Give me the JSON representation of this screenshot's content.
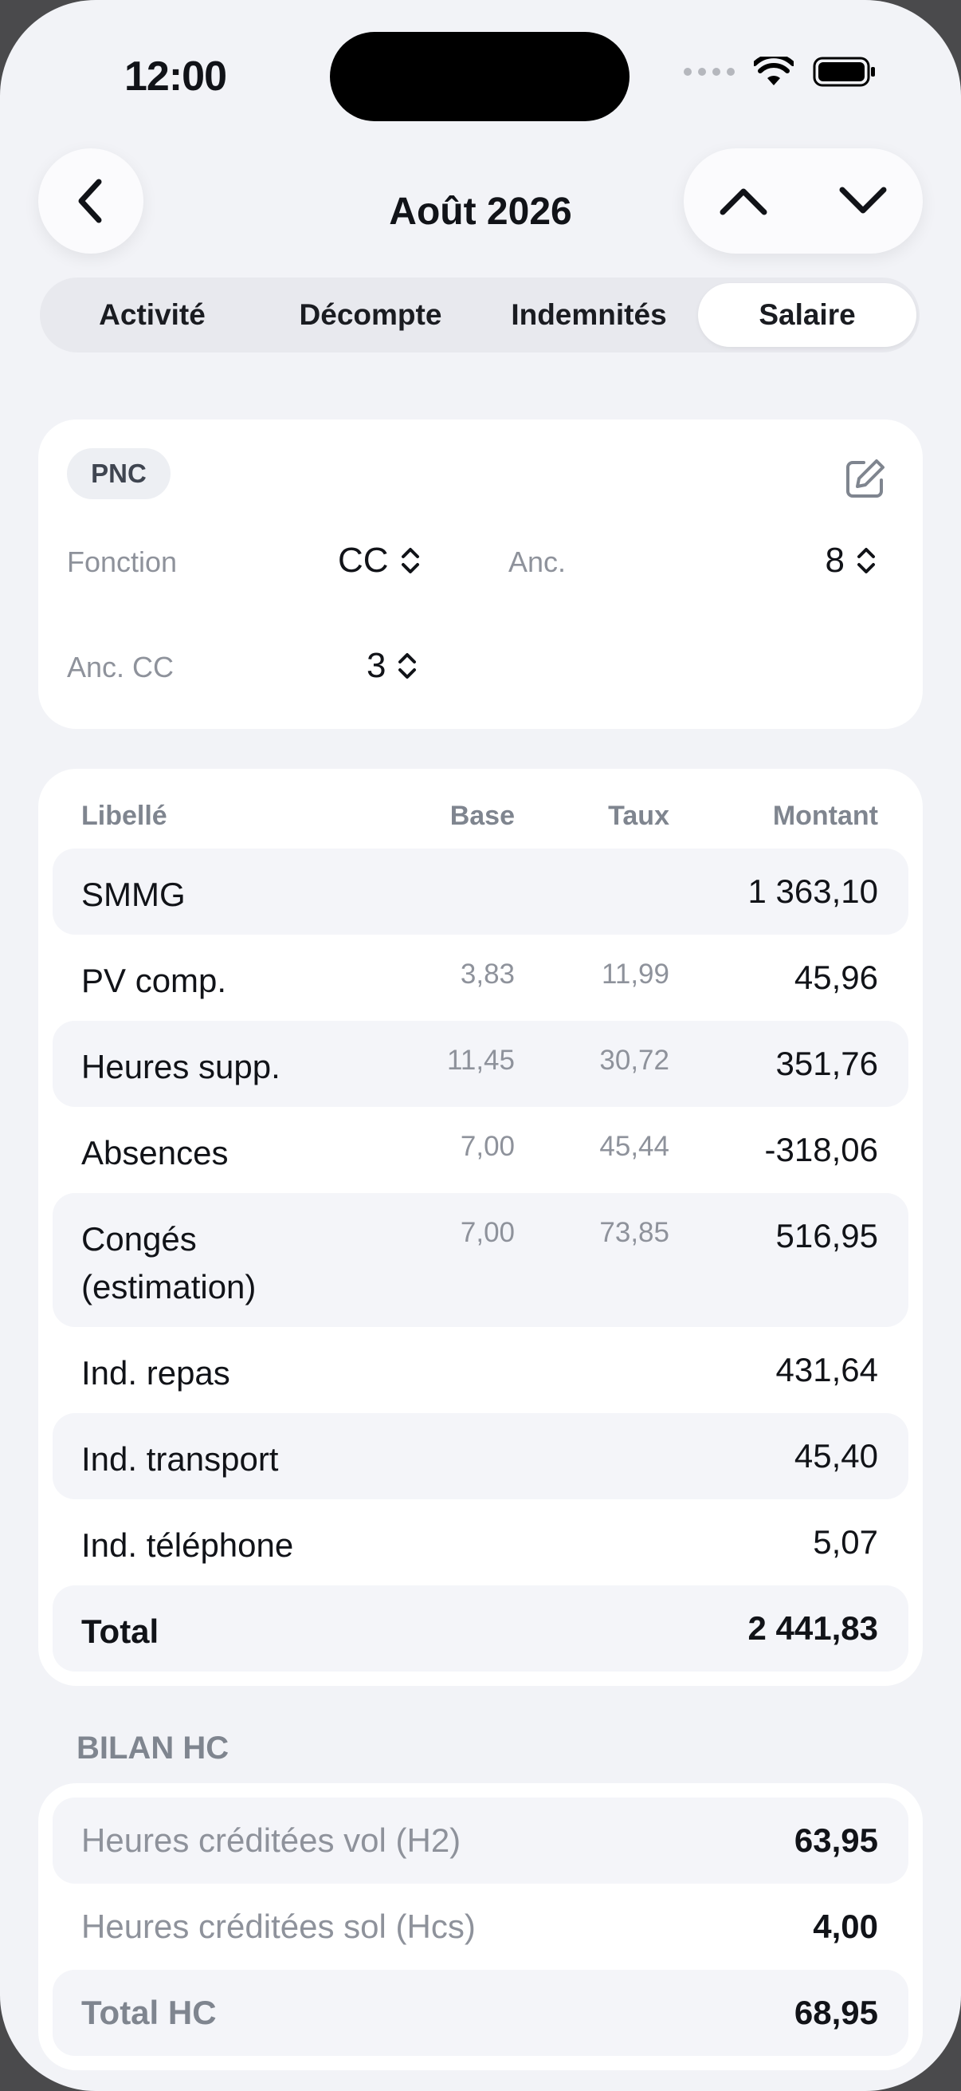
{
  "status": {
    "time": "12:00"
  },
  "nav": {
    "title": "Août 2026"
  },
  "tabs": [
    {
      "label": "Activité",
      "active": false
    },
    {
      "label": "Décompte",
      "active": false
    },
    {
      "label": "Indemnités",
      "active": false
    },
    {
      "label": "Salaire",
      "active": true
    }
  ],
  "profile": {
    "badge": "PNC",
    "fonction": {
      "label": "Fonction",
      "value": "CC"
    },
    "anc": {
      "label": "Anc.",
      "value": "8"
    },
    "anc_cc": {
      "label": "Anc. CC",
      "value": "3"
    }
  },
  "salary_table": {
    "headers": {
      "label": "Libellé",
      "base": "Base",
      "rate": "Taux",
      "amount": "Montant"
    },
    "rows": [
      {
        "label": "SMMG",
        "base": "",
        "rate": "",
        "amount": "1 363,10"
      },
      {
        "label": "PV comp.",
        "base": "3,83",
        "rate": "11,99",
        "amount": "45,96"
      },
      {
        "label": "Heures supp.",
        "base": "11,45",
        "rate": "30,72",
        "amount": "351,76"
      },
      {
        "label": "Absences",
        "base": "7,00",
        "rate": "45,44",
        "amount": "-318,06"
      },
      {
        "label": "Congés (estimation)",
        "base": "7,00",
        "rate": "73,85",
        "amount": "516,95"
      },
      {
        "label": "Ind. repas",
        "base": "",
        "rate": "",
        "amount": "431,64"
      },
      {
        "label": "Ind. transport",
        "base": "",
        "rate": "",
        "amount": "45,40"
      },
      {
        "label": "Ind. téléphone",
        "base": "",
        "rate": "",
        "amount": "5,07"
      }
    ],
    "total": {
      "label": "Total",
      "amount": "2 441,83"
    }
  },
  "bilan_hc": {
    "title": "BILAN HC",
    "rows": [
      {
        "label": "Heures créditées vol (H2)",
        "value": "63,95"
      },
      {
        "label": "Heures créditées sol (Hcs)",
        "value": "4,00"
      }
    ],
    "total": {
      "label": "Total HC",
      "value": "68,95"
    }
  },
  "icons": {
    "back": "chevron-left-icon",
    "prev": "chevron-up-icon",
    "next": "chevron-down-icon",
    "edit": "edit-icon",
    "picker": "up-down-chevron-icon"
  }
}
